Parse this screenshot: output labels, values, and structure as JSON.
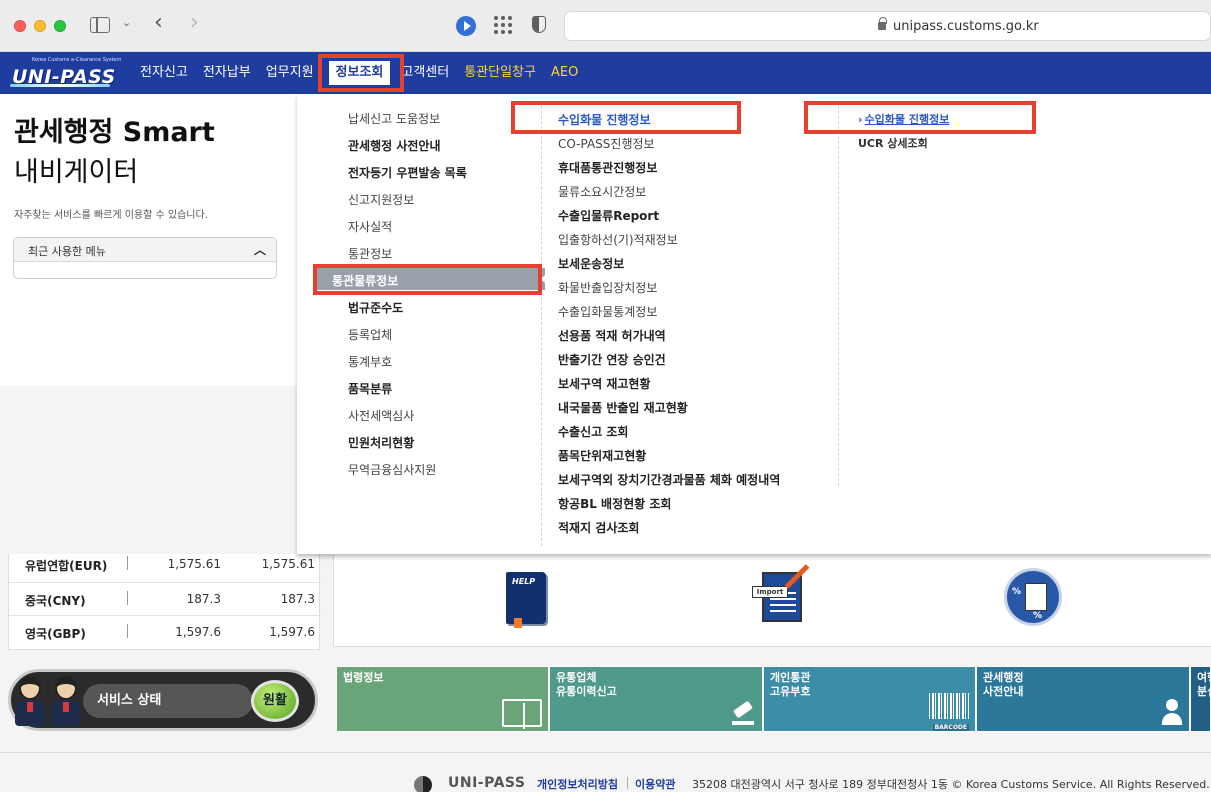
{
  "browser": {
    "url": "unipass.customs.go.kr"
  },
  "header": {
    "logo_sub": "Korea Customs e-Clearance System",
    "logo_main": "UNI-PASS",
    "nav": [
      {
        "label": "전자신고"
      },
      {
        "label": "전자납부"
      },
      {
        "label": "업무지원"
      },
      {
        "label": "정보조회"
      },
      {
        "label": "고객센터"
      },
      {
        "label": "통관단일창구"
      },
      {
        "label": "AEO"
      }
    ]
  },
  "navigator": {
    "title_line1": "관세행정 Smart",
    "title_line2": "내비게이터",
    "description": "자주찾는 서비스를 빠르게 이용할 수 있습니다.",
    "recent_menu_label": "최근 사용한 메뉴"
  },
  "menu_col1": [
    {
      "label": "납세신고 도움정보",
      "bold": false
    },
    {
      "label": "관세행정 사전안내",
      "bold": true
    },
    {
      "label": "전자등기 우편발송 목록",
      "bold": true
    },
    {
      "label": "신고지원정보",
      "bold": false
    },
    {
      "label": "자사실적",
      "bold": false
    },
    {
      "label": "통관정보",
      "bold": false
    },
    {
      "label": "통관물류정보",
      "bold": true
    },
    {
      "label": "법규준수도",
      "bold": false
    },
    {
      "label": "등록업체",
      "bold": false
    },
    {
      "label": "통계부호",
      "bold": false
    },
    {
      "label": "품목분류",
      "bold": true
    },
    {
      "label": "사전세액심사",
      "bold": false
    },
    {
      "label": "민원처리현황",
      "bold": true
    },
    {
      "label": "무역금융심사지원",
      "bold": false
    }
  ],
  "menu_col2": [
    {
      "label": "수입화물 진행정보"
    },
    {
      "label": "CO-PASS진행정보"
    },
    {
      "label": "휴대품통관진행정보"
    },
    {
      "label": "물류소요시간정보"
    },
    {
      "label": "수출입물류Report"
    },
    {
      "label": "입출항하선(기)적재정보"
    },
    {
      "label": "보세운송정보"
    },
    {
      "label": "화물반출입장치정보"
    },
    {
      "label": "수출입화물통계정보"
    },
    {
      "label": "선용품 적재 허가내역"
    },
    {
      "label": "반출기간 연장 승인건"
    },
    {
      "label": "보세구역 재고현황"
    },
    {
      "label": "내국물품 반출입 재고현황"
    },
    {
      "label": "수출신고 조회"
    },
    {
      "label": "품목단위재고현황"
    },
    {
      "label": "보세구역외 장치기간경과물품 체화 예정내역"
    },
    {
      "label": "항공BL 배정현황 조회"
    },
    {
      "label": "적재지 검사조회"
    }
  ],
  "menu_col3": [
    {
      "label": "수입화물 진행정보"
    },
    {
      "label": "UCR 상세조회"
    }
  ],
  "exchange_rates": [
    {
      "currency": "유럽연합(EUR)",
      "v1": "1,575.61",
      "v2": "1,575.61"
    },
    {
      "currency": "중국(CNY)",
      "v1": "187.3",
      "v2": "187.3"
    },
    {
      "currency": "영국(GBP)",
      "v1": "1,597.6",
      "v2": "1,597.6"
    }
  ],
  "icons": {
    "help_label": "HELP",
    "import_label": "Import",
    "pct": "%"
  },
  "service": {
    "label": "서비스 상태",
    "status": "원활"
  },
  "tiles": [
    {
      "line1": "법령정보",
      "line2": ""
    },
    {
      "line1": "유통업체",
      "line2": "유통이력신고"
    },
    {
      "line1": "개인통관",
      "line2": "고유부호"
    },
    {
      "line1": "관세행정",
      "line2": "사전안내"
    },
    {
      "line1": "여행",
      "line2": "분실"
    }
  ],
  "barcode_label": "BARCODE",
  "footer": {
    "logo": "UNI-PASS",
    "privacy": "개인정보처리방침",
    "terms": "이용약관",
    "copyright": "35208 대전광역시 서구 청사로 189 정부대전청사 1동 © Korea Customs Service. All Rights Reserved."
  },
  "colors": {
    "header_bg": "#1f3d9e",
    "highlight": "#e6412e",
    "link_blue": "#2a58c9",
    "status_green": "#4fa21c"
  }
}
